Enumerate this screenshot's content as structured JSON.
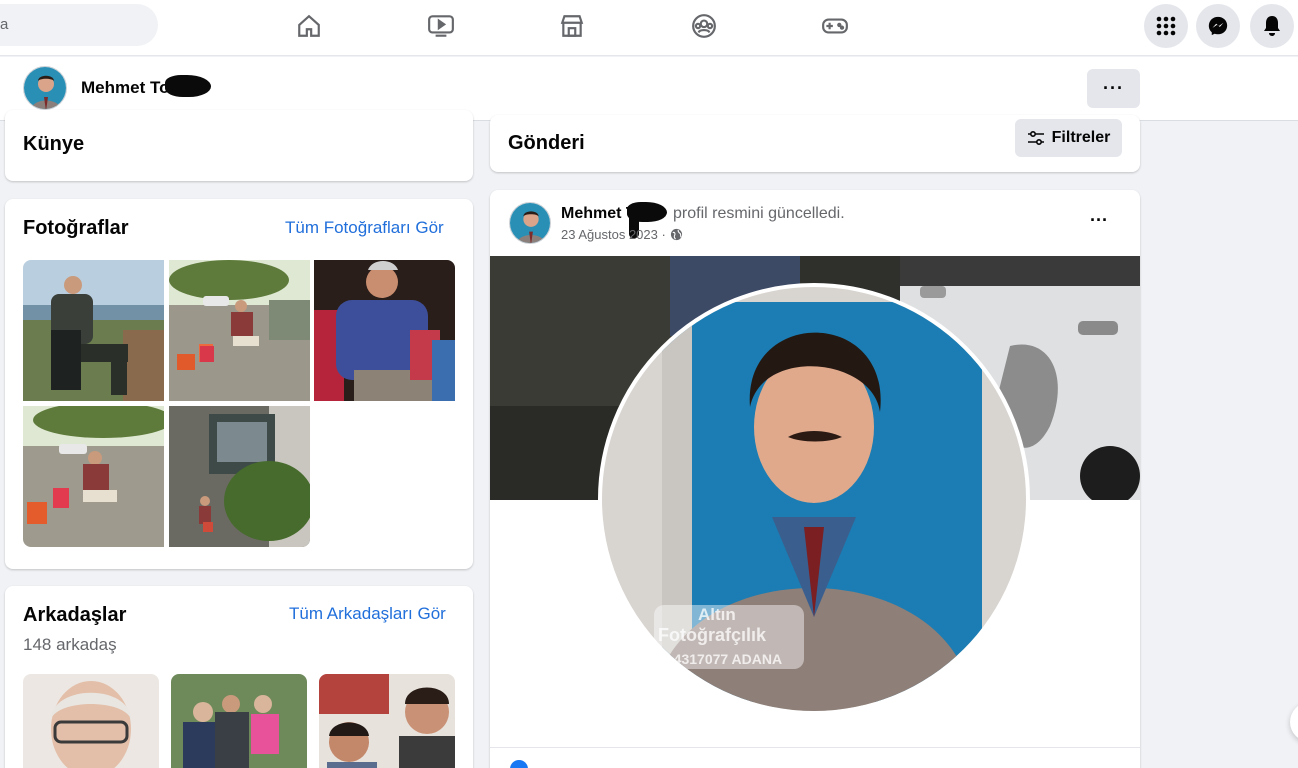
{
  "search": {
    "text": "a"
  },
  "nav": {
    "icons": [
      "home-icon",
      "watch-icon",
      "marketplace-icon",
      "groups-icon",
      "gaming-icon"
    ],
    "right_icons": [
      "menu-grid-icon",
      "messenger-icon",
      "notifications-icon"
    ]
  },
  "profile_bar": {
    "name": "Mehmet To",
    "more": "···"
  },
  "kunye": {
    "title": "Künye"
  },
  "photos": {
    "title": "Fotoğraflar",
    "link": "Tüm Fotoğrafları Gör"
  },
  "friends": {
    "title": "Arkadaşlar",
    "link": "Tüm Arkadaşları Gör",
    "count": "148 arkadaş"
  },
  "posts_header": {
    "title": "Gönderi",
    "filter_label": "Filtreler"
  },
  "post": {
    "author": "Mehmet T",
    "action": "profil resmini güncelledi.",
    "date": "23 Ağustos 2023 ·",
    "more": "···",
    "photo_caption_line1": "Altın",
    "photo_caption_line2": "Fotoğrafçılık",
    "photo_caption_line3": "5 4317077 ADANA"
  },
  "colors": {
    "accent": "#216fdb",
    "background": "#f0f2f5"
  }
}
